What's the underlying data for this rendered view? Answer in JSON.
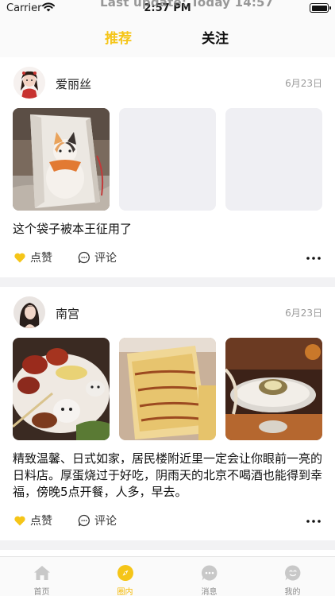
{
  "status_bar": {
    "carrier": "Carrier",
    "time": "2:57 PM",
    "overlay_text": "Last update: Today 14:57"
  },
  "top_tabs": {
    "active": "推荐",
    "other": "关注",
    "active_color": "#f5c518"
  },
  "posts": [
    {
      "username": "爱丽丝",
      "date": "6月23日",
      "caption": "这个袋子被本王征用了",
      "like_label": "点赞",
      "comment_label": "评论"
    },
    {
      "username": "南宫",
      "date": "6月23日",
      "caption": "精致温馨、日式如家，居民楼附近里一定会让你眼前一亮的日料店。厚蛋烧过于好吃，阴雨天的北京不喝酒也能得到幸福，傍晚5点开餐，人多，早去。",
      "like_label": "点赞",
      "comment_label": "评论"
    }
  ],
  "tab_bar": {
    "items": [
      {
        "label": "首页",
        "icon": "home-icon"
      },
      {
        "label": "圈内",
        "icon": "compass-icon"
      },
      {
        "label": "消息",
        "icon": "message-icon"
      },
      {
        "label": "我的",
        "icon": "profile-icon"
      }
    ],
    "active_color": "#f5b800"
  }
}
